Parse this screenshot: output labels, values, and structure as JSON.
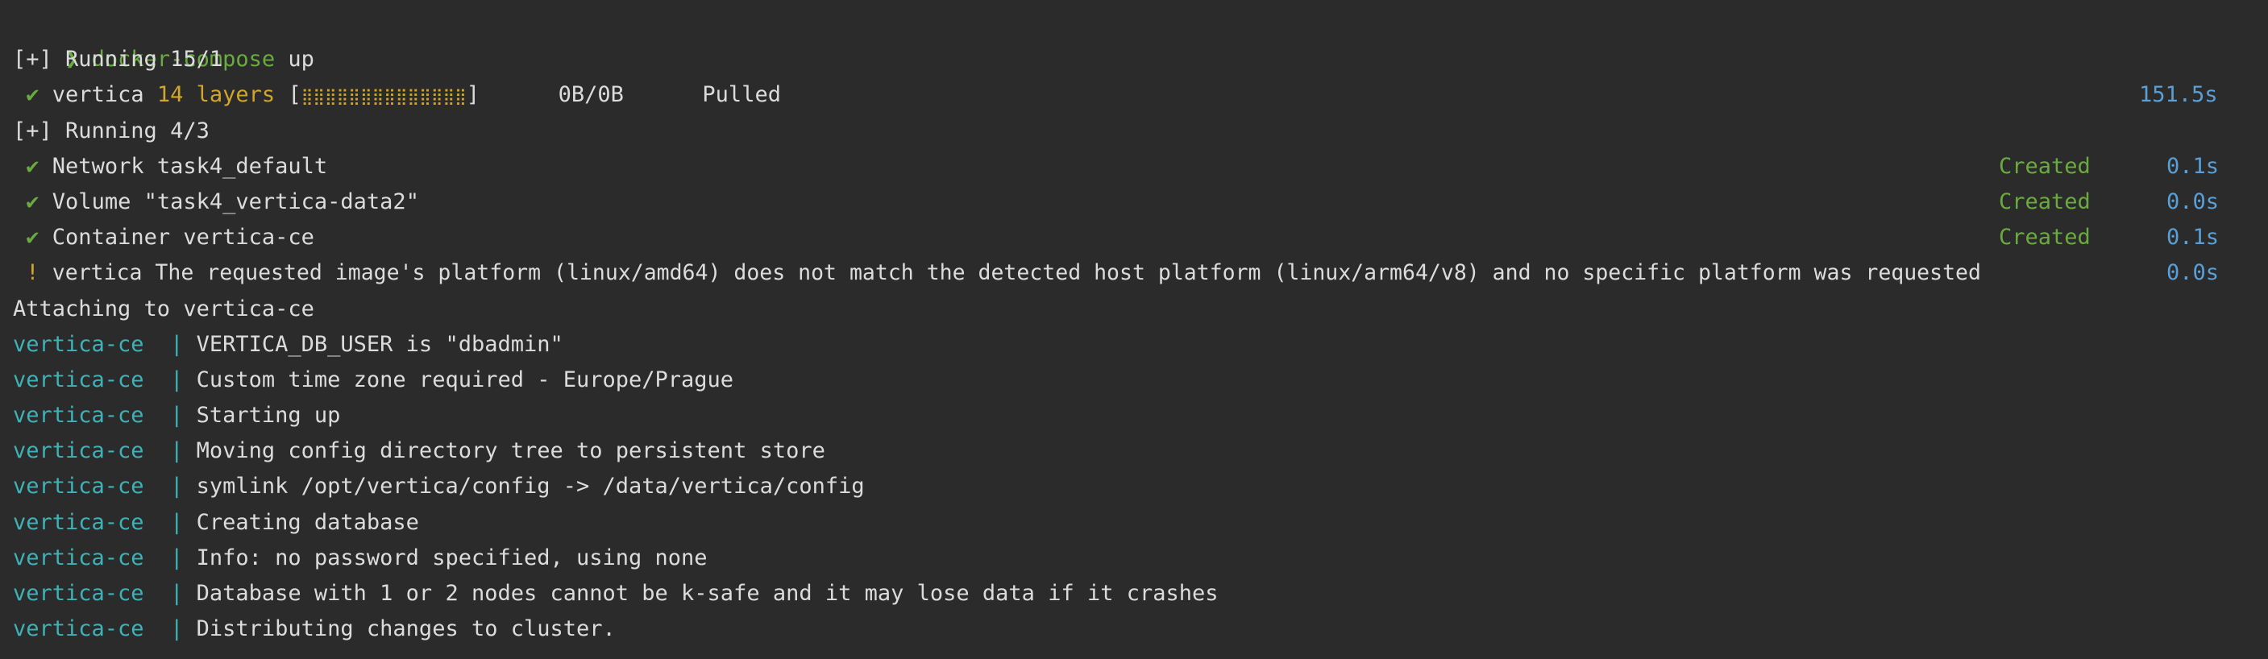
{
  "terminal": {
    "command": {
      "prompt": "❯",
      "cmd": "docker-compose",
      "arg": "up"
    },
    "running1": "[+] Running 15/1",
    "pull_line": {
      "check": "✔",
      "name": "vertica",
      "layers": "14 layers",
      "bar_open": "[",
      "bar": "⣿⣿⣿⣿⣿⣿⣿⣿⣿⣿⣿⣿⣿⣿",
      "bar_close": "]",
      "size": "0B/0B",
      "status": "Pulled",
      "time": "151.5s"
    },
    "running2": "[+] Running 4/3",
    "resources": [
      {
        "check": "✔",
        "label": "Network task4_default",
        "status": "Created",
        "time": "0.1s"
      },
      {
        "check": "✔",
        "label": "Volume \"task4_vertica-data2\"",
        "status": "Created",
        "time": "0.0s"
      },
      {
        "check": "✔",
        "label": "Container vertica-ce",
        "status": "Created",
        "time": "0.1s"
      }
    ],
    "warning": {
      "mark": "!",
      "text": "vertica The requested image's platform (linux/amd64) does not match the detected host platform (linux/arm64/v8) and no specific platform was requested",
      "time": "0.0s"
    },
    "attaching": "Attaching to vertica-ce",
    "container_prefix": "vertica-ce  |",
    "logs": [
      "VERTICA_DB_USER is \"dbadmin\"",
      "Custom time zone required - Europe/Prague",
      "Starting up",
      "Moving config directory tree to persistent store",
      "symlink /opt/vertica/config -> /data/vertica/config",
      "Creating database",
      "Info: no password specified, using none",
      "Database with 1 or 2 nodes cannot be k-safe and it may lose data if it crashes",
      "Distributing changes to cluster."
    ]
  }
}
